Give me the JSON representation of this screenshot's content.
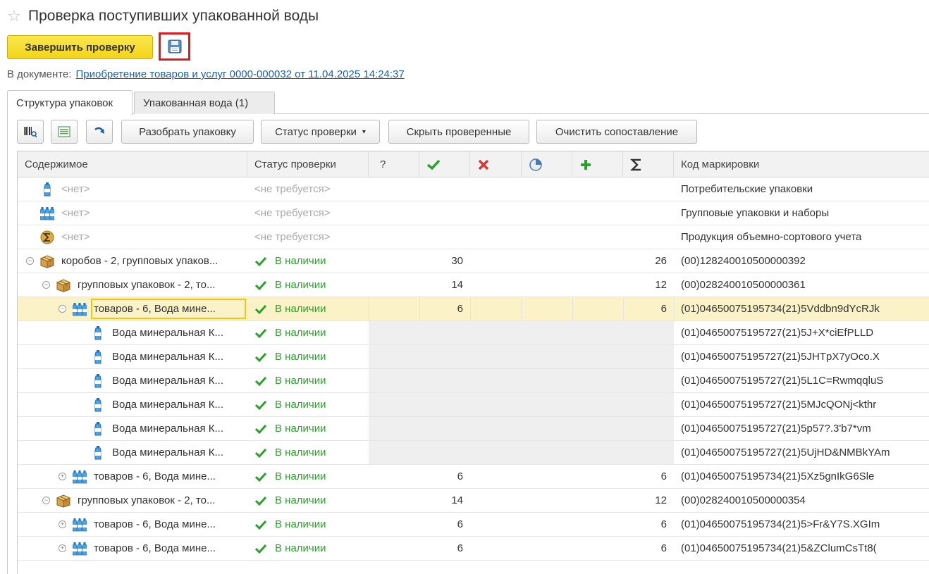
{
  "window": {
    "title": "Проверка поступивших упакованной воды"
  },
  "toolbar_top": {
    "finish_label": "Завершить проверку"
  },
  "document": {
    "label": "В документе:",
    "link": "Приобретение товаров и услуг 0000-000032 от 11.04.2025 14:24:37"
  },
  "tabs": [
    {
      "label": "Структура упаковок"
    },
    {
      "label": "Упакованная вода (1)"
    }
  ],
  "grid_toolbar": {
    "unpack_label": "Разобрать упаковку",
    "status_label": "Статус проверки",
    "hide_checked_label": "Скрыть проверенные",
    "clear_match_label": "Очистить сопоставление"
  },
  "columns": {
    "content": "Содержимое",
    "status": "Статус проверки",
    "question": "?",
    "code": "Код маркировки"
  },
  "rows": [
    {
      "content": "<нет>",
      "status": "<не требуется>",
      "count": "",
      "total": "",
      "code": "Потребительские упаковки",
      "icon": "bottle-icon"
    },
    {
      "content": "<нет>",
      "status": "<не требуется>",
      "count": "",
      "total": "",
      "code": "Групповые упаковки и наборы",
      "icon": "bottles-group-icon"
    },
    {
      "content": "<нет>",
      "status": "<не требуется>",
      "count": "",
      "total": "",
      "code": "Продукция объемно-сортового учета",
      "icon": "sigma-circle-icon"
    },
    {
      "content": "коробов - 2, групповых упаков...",
      "status": "В наличии",
      "count": "30",
      "total": "26",
      "code": "(00)128240010500000392",
      "icon": "box-icon"
    },
    {
      "content": "групповых упаковок - 2, то...",
      "status": "В наличии",
      "count": "14",
      "total": "12",
      "code": "(00)028240010500000361",
      "icon": "box-icon"
    },
    {
      "content": "товаров - 6, Вода мине...",
      "status": "В наличии",
      "count": "6",
      "total": "6",
      "code": "(01)04650075195734(21)5Vddbn9dYcRJk",
      "icon": "bottles-group-icon"
    },
    {
      "content": "Вода минеральная К...",
      "status": "В наличии",
      "count": "",
      "total": "",
      "code": "(01)04650075195727(21)5J+X*ciEfPLLD",
      "icon": "bottle-icon"
    },
    {
      "content": "Вода минеральная К...",
      "status": "В наличии",
      "count": "",
      "total": "",
      "code": "(01)04650075195727(21)5JHTpX7yOco.X",
      "icon": "bottle-icon"
    },
    {
      "content": "Вода минеральная К...",
      "status": "В наличии",
      "count": "",
      "total": "",
      "code": "(01)04650075195727(21)5L1C=RwmqqluS",
      "icon": "bottle-icon"
    },
    {
      "content": "Вода минеральная К...",
      "status": "В наличии",
      "count": "",
      "total": "",
      "code": "(01)04650075195727(21)5MJcQONj<kthr",
      "icon": "bottle-icon"
    },
    {
      "content": "Вода минеральная К...",
      "status": "В наличии",
      "count": "",
      "total": "",
      "code": "(01)04650075195727(21)5p57?.3'b7*vm",
      "icon": "bottle-icon"
    },
    {
      "content": "Вода минеральная К...",
      "status": "В наличии",
      "count": "",
      "total": "",
      "code": "(01)04650075195727(21)5UjHD&NMBkYAm",
      "icon": "bottle-icon"
    },
    {
      "content": "товаров - 6, Вода мине...",
      "status": "В наличии",
      "count": "6",
      "total": "6",
      "code": "(01)04650075195734(21)5Xz5gnIkG6Sle",
      "icon": "bottles-group-icon"
    },
    {
      "content": "групповых упаковок - 2, то...",
      "status": "В наличии",
      "count": "14",
      "total": "12",
      "code": "(00)028240010500000354",
      "icon": "box-icon"
    },
    {
      "content": "товаров - 6, Вода мине...",
      "status": "В наличии",
      "count": "6",
      "total": "6",
      "code": "(01)04650075195734(21)5>Fr&Y7S.XGIm",
      "icon": "bottles-group-icon"
    },
    {
      "content": "товаров - 6, Вода мине...",
      "status": "В наличии",
      "count": "6",
      "total": "6",
      "code": "(01)04650075195734(21)5&ZClumCsTt8(",
      "icon": "bottles-group-icon"
    }
  ],
  "colors": {
    "accent_yellow": "#f3d41a",
    "ok_green": "#2aa22a",
    "link_blue": "#1b5ea8",
    "selected_row": "#fbf2c8"
  }
}
